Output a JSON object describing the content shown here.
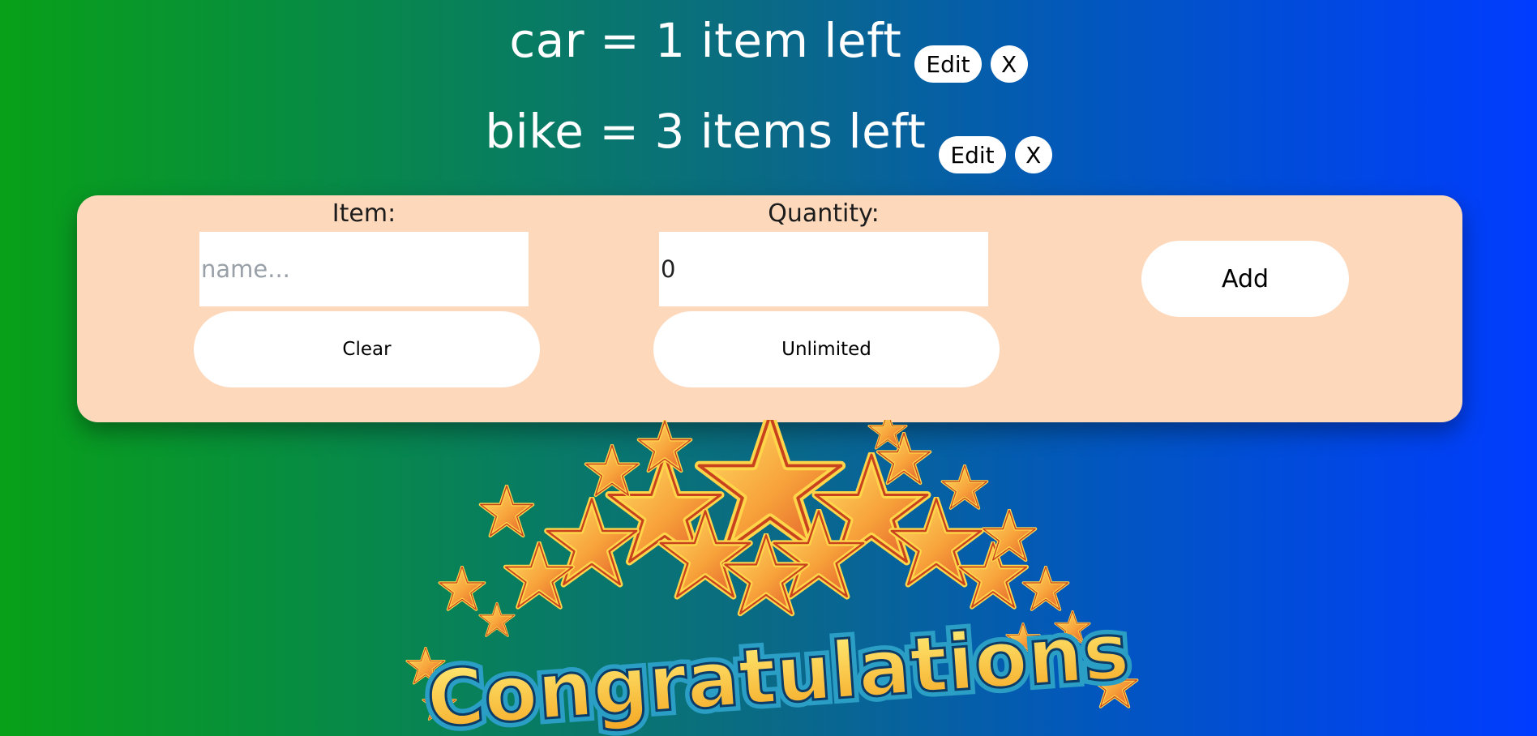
{
  "items": [
    {
      "text": "car = 1 item left",
      "edit_label": "Edit",
      "remove_label": "X"
    },
    {
      "text": "bike = 3 items left",
      "edit_label": "Edit",
      "remove_label": "X"
    }
  ],
  "form": {
    "item_label": "Item:",
    "item_value": "",
    "item_placeholder": "name...",
    "quantity_label": "Quantity:",
    "quantity_value": "0",
    "clear_label": "Clear",
    "unlimited_label": "Unlimited",
    "add_label": "Add"
  },
  "banner": {
    "text": "Congratulations"
  },
  "colors": {
    "gradient_left": "#08a018",
    "gradient_right": "#003cff",
    "panel": "#fdd8bb",
    "button": "#ffffff",
    "star_fill": "#f7a23a",
    "star_outline": "#ffd54a",
    "text_fill": "#ffc431",
    "text_outline": "#2ec8e8"
  }
}
